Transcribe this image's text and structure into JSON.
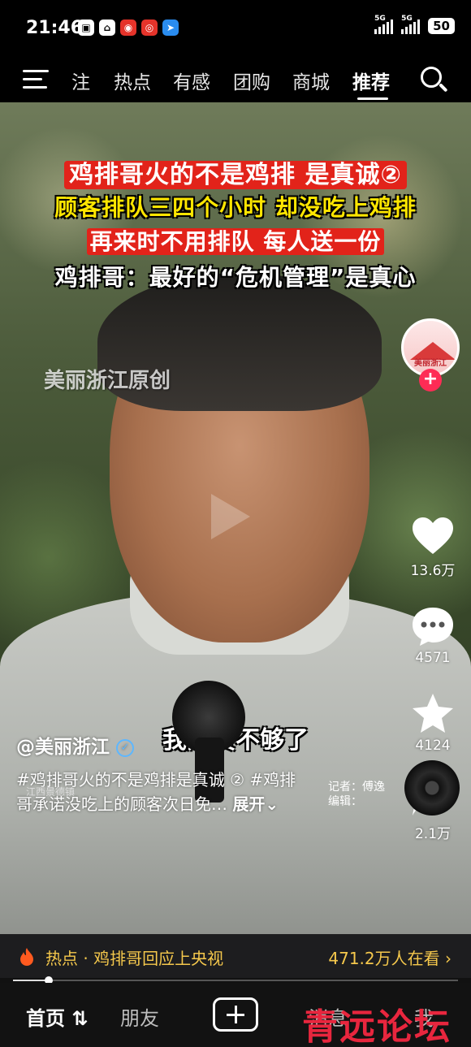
{
  "status_bar": {
    "time": "21:46",
    "signal1": "5G",
    "signal2": "5G",
    "battery": "50"
  },
  "top_nav": {
    "tabs": [
      {
        "label": "注",
        "active": false
      },
      {
        "label": "热点",
        "active": false
      },
      {
        "label": "有感",
        "active": false
      },
      {
        "label": "团购",
        "active": false
      },
      {
        "label": "商城",
        "active": false
      },
      {
        "label": "推荐",
        "active": true
      }
    ]
  },
  "video": {
    "headline_line1": "鸡排哥火的不是鸡排 是真诚②",
    "headline_line2": "顾客排队三四个小时 却没吃上鸡排",
    "headline_line3": "再来时不用排队 每人送一份",
    "headline_line4": "鸡排哥：最好的“危机管理”是真心",
    "watermark": "美丽浙江原创",
    "subtitle": "我的货不够了",
    "tiny_caption": "江西景德镇",
    "reporter_line1": "记者：傅逸",
    "reporter_line2": "编辑："
  },
  "actions": {
    "avatar_text": "美丽浙江",
    "follow_symbol": "+",
    "likes": "13.6万",
    "comments": "4571",
    "favorites": "4124",
    "shares": "2.1万"
  },
  "info": {
    "author": "@美丽浙江",
    "verified_symbol": "✓",
    "desc_line1": "#鸡排哥火的不是鸡排是真诚 ② #鸡排",
    "desc_line2": "哥承诺没吃上的顾客次日免…",
    "expand": "展开⌄"
  },
  "hot_bar": {
    "text": "热点 · 鸡排哥回应上央视",
    "count": "471.2万人在看 ›"
  },
  "progress": {
    "fraction": 0.08
  },
  "bottom_nav": {
    "home": "首页",
    "friends": "朋友",
    "messages": "消息",
    "me": "我"
  },
  "forum_watermark": "青远论坛",
  "colors": {
    "accent_red": "#e2231a",
    "hot_yellow": "#f5c84c",
    "follow_pink": "#fe2c55"
  }
}
